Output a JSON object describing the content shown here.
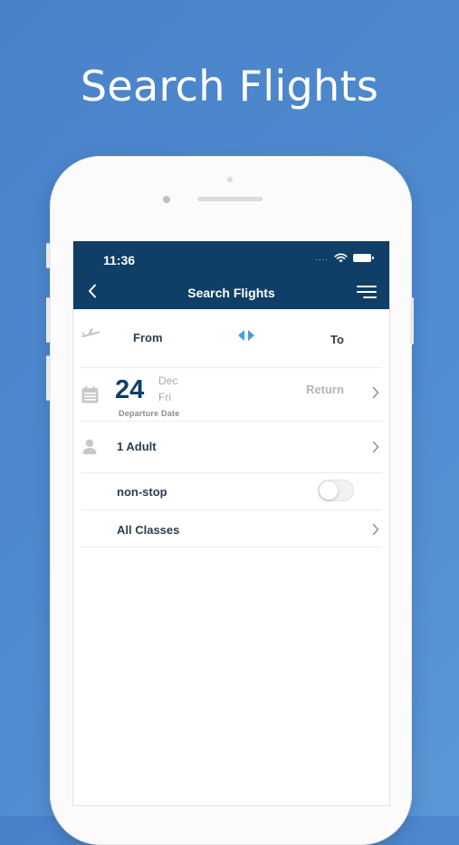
{
  "promo": {
    "title": "Search Flights"
  },
  "status_bar": {
    "time": "11:36",
    "signal": "...."
  },
  "nav": {
    "title": "Search Flights",
    "back_icon": "chevron-left-icon",
    "menu_icon": "hamburger-menu-icon"
  },
  "route": {
    "from_label": "From",
    "to_label": "To",
    "plane_icon": "plane-icon",
    "swap_icon": "swap-arrows-icon"
  },
  "date": {
    "day": "24",
    "month": "Dec",
    "weekday": "Fri",
    "caption": "Departure Date",
    "return_label": "Return"
  },
  "passengers": {
    "label": "1 Adult"
  },
  "nonstop": {
    "label": "non-stop",
    "enabled": false
  },
  "cabin": {
    "label": "All Classes"
  },
  "colors": {
    "background": "#4f8cd0",
    "navbar": "#0f3f66",
    "accent": "#3ea0e6",
    "date_number": "#0f3f66"
  }
}
